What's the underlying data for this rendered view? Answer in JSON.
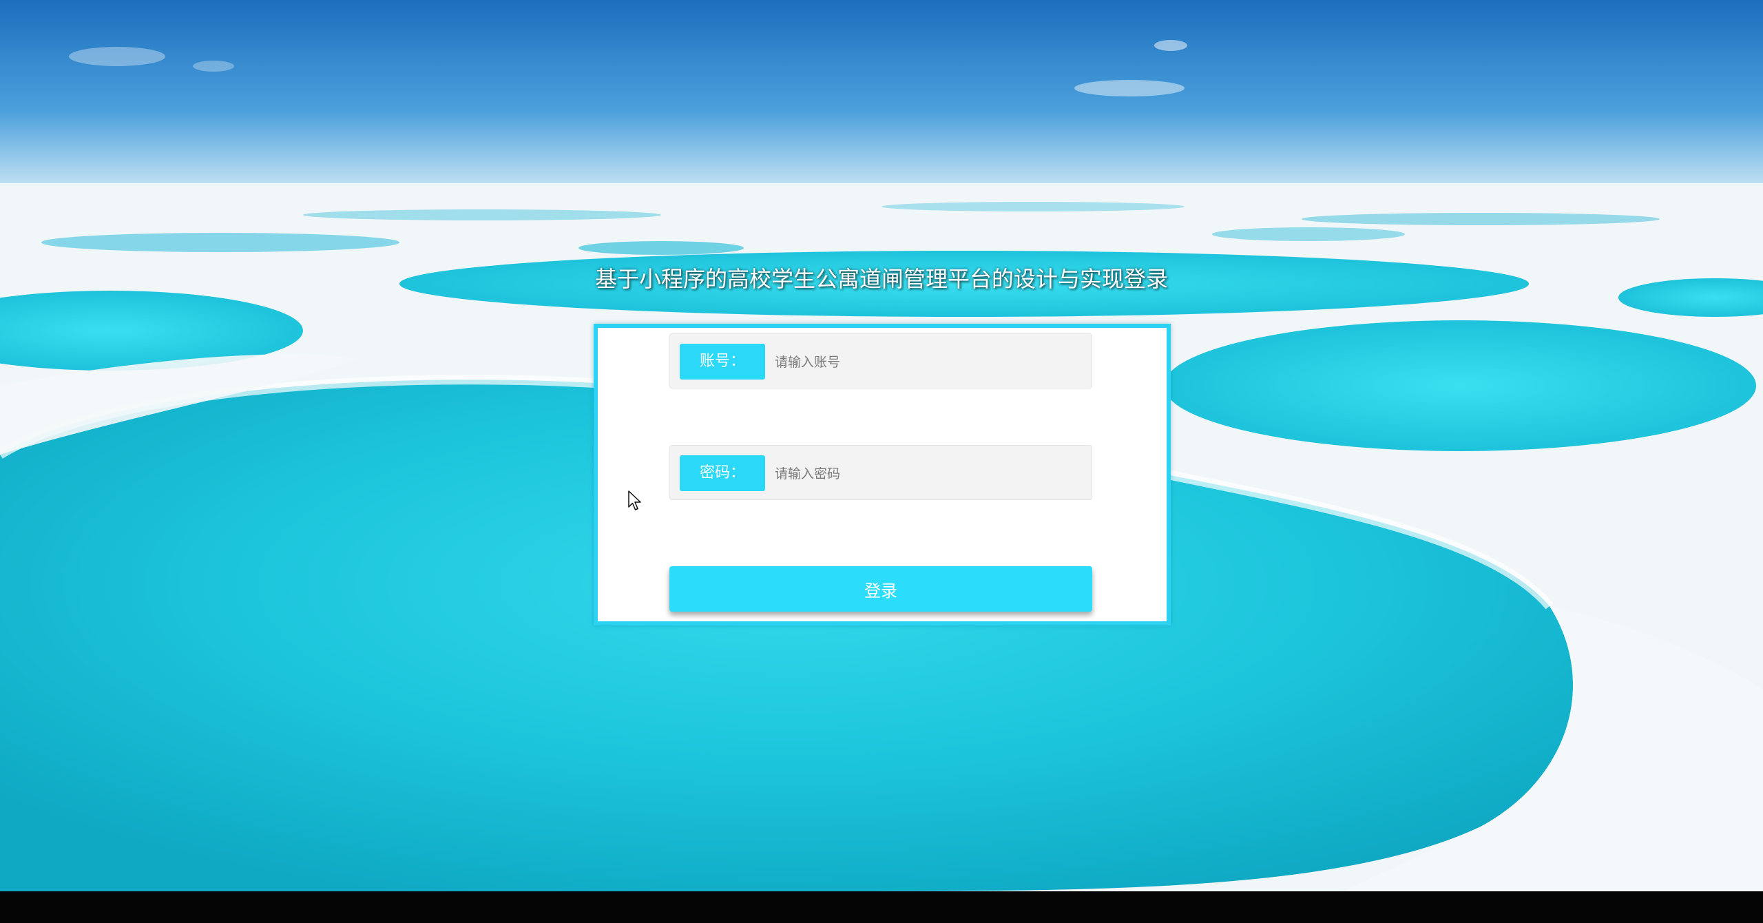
{
  "page": {
    "title": "基于小程序的高校学生公寓道闸管理平台的设计与实现登录"
  },
  "form": {
    "account_label": "账号：",
    "account_placeholder": "请输入账号",
    "account_value": "",
    "password_label": "密码：",
    "password_placeholder": "请输入密码",
    "password_value": "",
    "login_label": "登录"
  },
  "colors": {
    "accent": "#2bd8f7",
    "panel_border": "#2bd2f2",
    "field_bg": "#f3f3f3",
    "lake": "#1fc6dc",
    "sky": "#2a83cc"
  },
  "icons": {
    "cursor": "mouse-pointer-icon"
  }
}
